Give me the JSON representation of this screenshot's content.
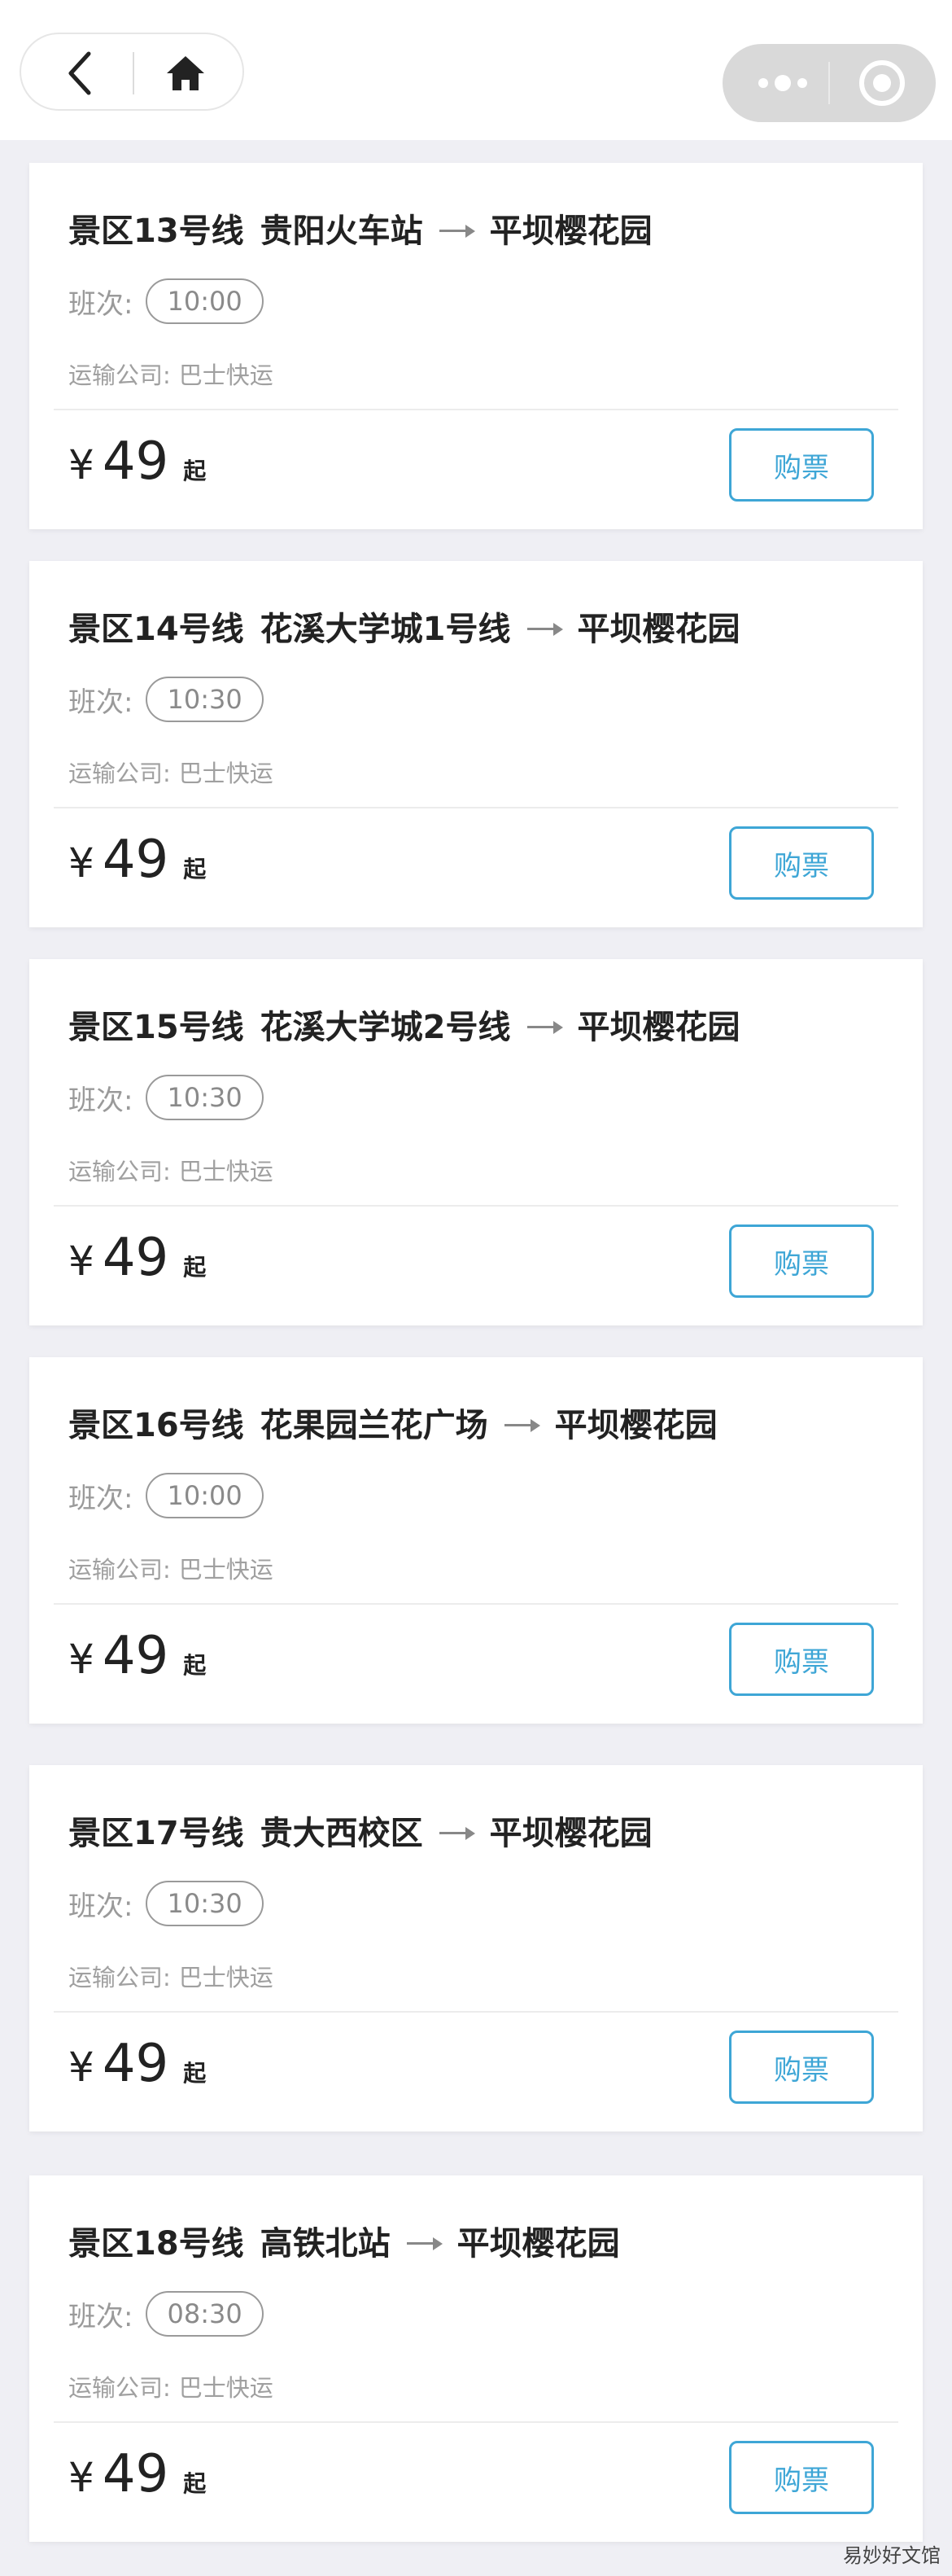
{
  "nav": {
    "back_icon": "chevron-left-icon",
    "home_icon": "home-icon",
    "more_icon": "more-dots-icon",
    "close_icon": "target-close-icon"
  },
  "colors": {
    "accent": "#3ea6d6",
    "background": "#efeff4",
    "muted_text": "#9a9a9a"
  },
  "routes": [
    {
      "line": "景区13号线",
      "from": "贵阳火车站",
      "to": "平坝樱花园",
      "schedule_label": "班次:",
      "time": "10:00",
      "company_label": "运输公司:",
      "company": "巴士快运",
      "currency": "¥",
      "price": "49",
      "price_suffix": "起",
      "buy_label": "购票"
    },
    {
      "line": "景区14号线",
      "from": "花溪大学城1号线",
      "to": "平坝樱花园",
      "schedule_label": "班次:",
      "time": "10:30",
      "company_label": "运输公司:",
      "company": "巴士快运",
      "currency": "¥",
      "price": "49",
      "price_suffix": "起",
      "buy_label": "购票"
    },
    {
      "line": "景区15号线",
      "from": "花溪大学城2号线",
      "to": "平坝樱花园",
      "schedule_label": "班次:",
      "time": "10:30",
      "company_label": "运输公司:",
      "company": "巴士快运",
      "currency": "¥",
      "price": "49",
      "price_suffix": "起",
      "buy_label": "购票"
    },
    {
      "line": "景区16号线",
      "from": "花果园兰花广场",
      "to": "平坝樱花园",
      "schedule_label": "班次:",
      "time": "10:00",
      "company_label": "运输公司:",
      "company": "巴士快运",
      "currency": "¥",
      "price": "49",
      "price_suffix": "起",
      "buy_label": "购票"
    },
    {
      "line": "景区17号线",
      "from": "贵大西校区",
      "to": "平坝樱花园",
      "schedule_label": "班次:",
      "time": "10:30",
      "company_label": "运输公司:",
      "company": "巴士快运",
      "currency": "¥",
      "price": "49",
      "price_suffix": "起",
      "buy_label": "购票"
    },
    {
      "line": "景区18号线",
      "from": "高铁北站",
      "to": "平坝樱花园",
      "schedule_label": "班次:",
      "time": "08:30",
      "company_label": "运输公司:",
      "company": "巴士快运",
      "currency": "¥",
      "price": "49",
      "price_suffix": "起",
      "buy_label": "购票"
    }
  ],
  "watermark": "易妙好文馆"
}
